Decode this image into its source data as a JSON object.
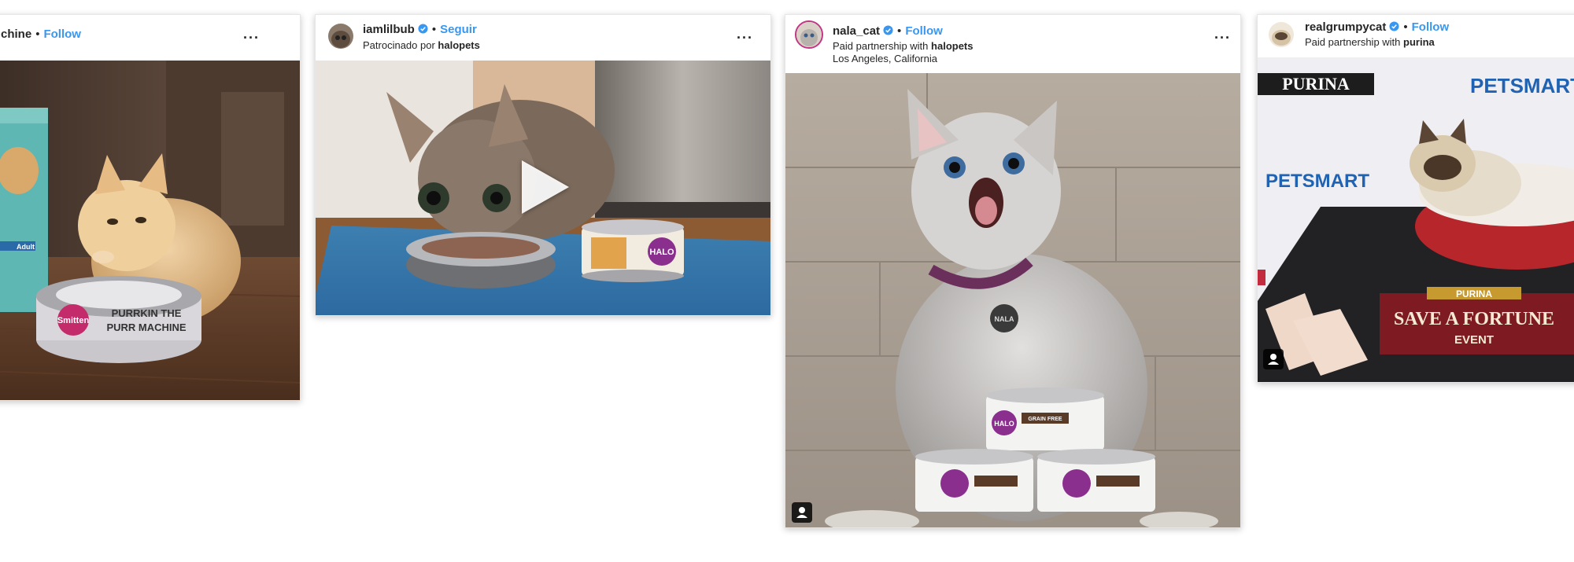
{
  "posts": [
    {
      "username": "chine",
      "follow_label": "Follow",
      "separator": "•",
      "more": "···",
      "bowl_text_1": "Smitten",
      "bowl_text_2": "PURRKIN THE",
      "bowl_text_3": "PURR MACHINE",
      "box_label": "Adult"
    },
    {
      "username": "iamlilbub",
      "follow_label": "Seguir",
      "separator": "•",
      "sponsor_prefix": "Patrocinado por",
      "sponsor_brand": "halopets",
      "more": "···",
      "can_brand": "HALO"
    },
    {
      "username": "nala_cat",
      "follow_label": "Follow",
      "separator": "•",
      "sponsor_prefix": "Paid partnership with",
      "sponsor_brand": "halopets",
      "location": "Los Angeles, California",
      "more": "···",
      "tag_text": "NALA",
      "can_brand": "HALO",
      "can_label": "GRAIN FREE"
    },
    {
      "username": "realgrumpycat",
      "follow_label": "Follow",
      "separator": "•",
      "sponsor_prefix": "Paid partnership with",
      "sponsor_brand": "purina",
      "brand_left": "PURINA",
      "brand_right_1": "PETSMART",
      "brand_right_2": "PETSMART",
      "event_brand": "PURINA",
      "event_line_1": "SAVE A FORTUNE",
      "event_line_2": "EVENT"
    }
  ],
  "colors": {
    "link_blue": "#3897f0",
    "verified_blue": "#3897f0",
    "text_dark": "#262626",
    "halo_purple": "#8b2f8f"
  },
  "icons": [
    "verified-badge-icon",
    "more-options-icon",
    "tagged-user-icon",
    "play-icon"
  ]
}
